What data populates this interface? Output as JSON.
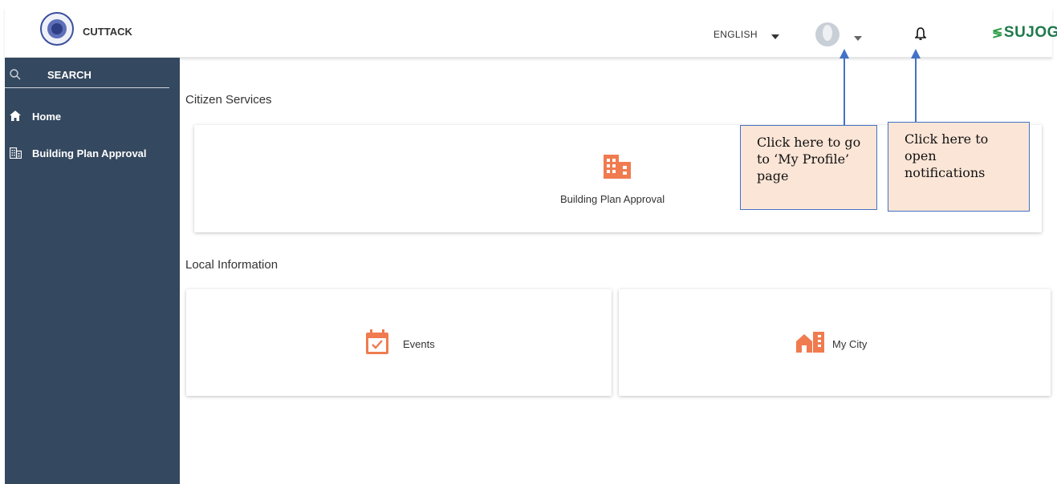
{
  "header": {
    "city_name": "CUTTACK",
    "language": "ENGLISH",
    "brand": "SUJOG",
    "brand_mark": "≶"
  },
  "sidebar": {
    "search_label": "SEARCH",
    "items": [
      {
        "label": "Home",
        "icon": "home-icon"
      },
      {
        "label": "Building Plan Approval",
        "icon": "building-icon"
      }
    ]
  },
  "main": {
    "citizen_services": {
      "title": "Citizen Services",
      "cards": [
        {
          "label": "Building Plan Approval",
          "icon": "building-icon"
        }
      ]
    },
    "local_information": {
      "title": "Local Information",
      "cards": [
        {
          "label": "Events",
          "icon": "calendar-check-icon"
        },
        {
          "label": "My City",
          "icon": "city-icon"
        }
      ]
    }
  },
  "callouts": {
    "profile": "Click here to go to ‘My Profile’ page",
    "notifications": "Click here to open notifications"
  },
  "colors": {
    "sidebar": "#34485f",
    "accent_icon": "#f07b4f",
    "brand": "#1f7a4b",
    "callout_fill": "#fbe5d6",
    "callout_border": "#4472c4"
  }
}
